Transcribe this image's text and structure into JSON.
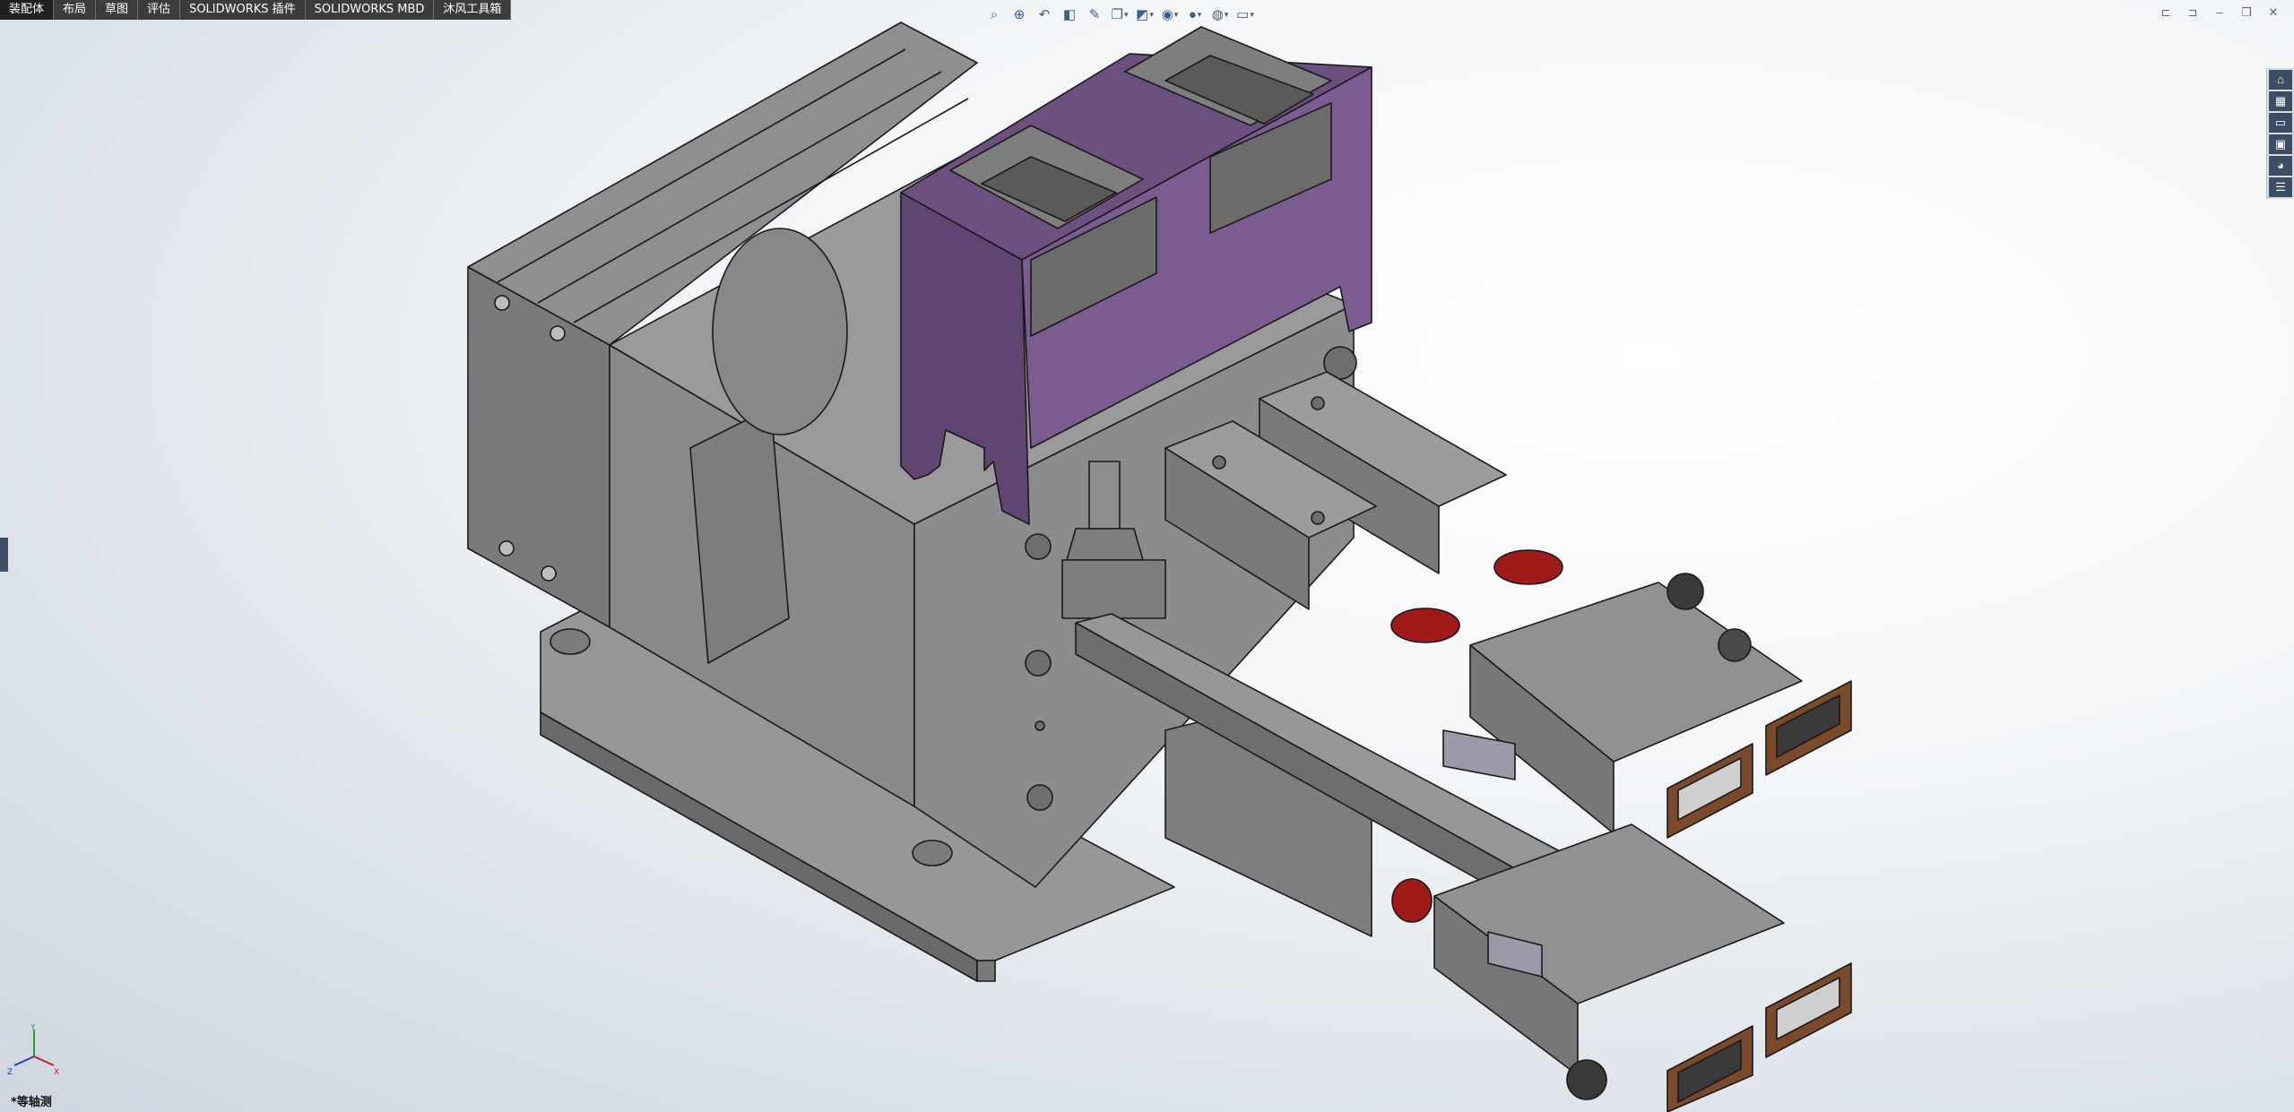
{
  "command_manager": {
    "tabs": [
      {
        "label": "装配体"
      },
      {
        "label": "布局"
      },
      {
        "label": "草图"
      },
      {
        "label": "评估"
      },
      {
        "label": "SOLIDWORKS 插件"
      },
      {
        "label": "SOLIDWORKS MBD"
      },
      {
        "label": "沐风工具箱"
      }
    ]
  },
  "view_toolbar": {
    "icons": [
      "zoom-to-fit-icon",
      "zoom-area-icon",
      "previous-view-icon",
      "section-view-icon",
      "dynamic-annotation-icon",
      "view-orientation-icon",
      "display-style-icon",
      "hide-show-items-icon",
      "edit-appearance-icon",
      "apply-scene-icon",
      "view-settings-icon"
    ]
  },
  "window_controls": {
    "icons": [
      "tile-left-icon",
      "tile-right-icon",
      "minimize-icon",
      "restore-icon",
      "close-icon"
    ]
  },
  "task_pane": {
    "icons": [
      "solidworks-resources-icon",
      "design-library-icon",
      "file-explorer-icon",
      "view-palette-icon",
      "appearances-icon",
      "custom-properties-icon"
    ]
  },
  "model": {
    "colors": {
      "body": "#8a8a8a",
      "body_dark": "#6f6f6f",
      "body_light": "#9e9e9e",
      "bracket": "#6b5080",
      "spring": "#a01a1a",
      "connector_frame": "#7a4a2a",
      "display": "#5a5a5a",
      "edge": "#1a1a1a"
    }
  },
  "triad": {
    "x_label": "X",
    "y_label": "Y",
    "z_label": "Z"
  },
  "view_label": "*等轴测"
}
